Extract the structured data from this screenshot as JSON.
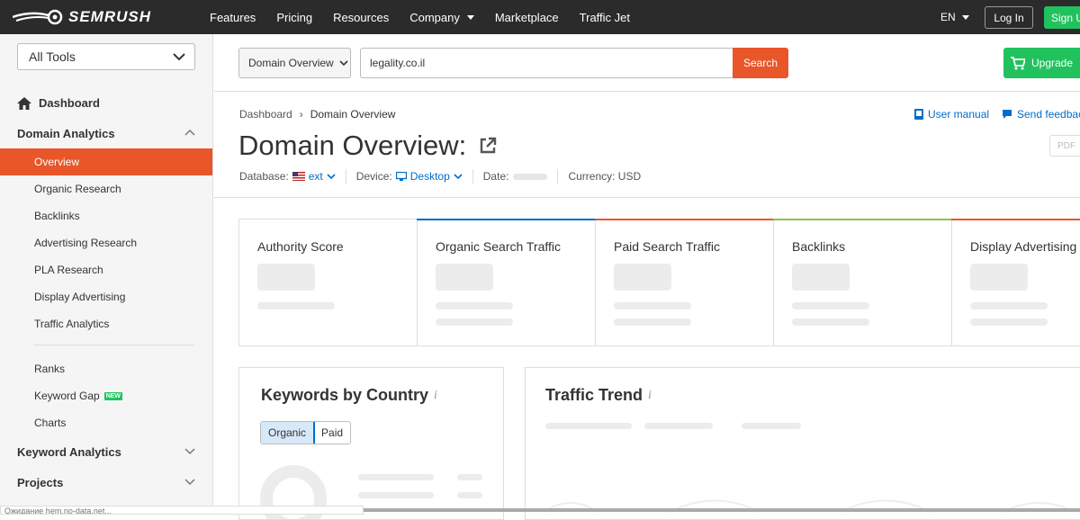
{
  "topbar": {
    "logo_text": "SEMRUSH",
    "nav": [
      "Features",
      "Pricing",
      "Resources",
      "Company",
      "Marketplace",
      "Traffic Jet"
    ],
    "lang": "EN",
    "login": "Log In",
    "signup": "Sign Up"
  },
  "sidebar": {
    "all_tools": "All Tools",
    "dashboard": "Dashboard",
    "domain_analytics": "Domain Analytics",
    "items": [
      "Overview",
      "Organic Research",
      "Backlinks",
      "Advertising Research",
      "PLA Research",
      "Display Advertising",
      "Traffic Analytics"
    ],
    "items2": [
      "Ranks",
      "Keyword Gap",
      "Charts"
    ],
    "new_badge": "NEW",
    "keyword_analytics": "Keyword Analytics",
    "projects": "Projects"
  },
  "search": {
    "db_select": "Domain Overview",
    "query": "legality.co.il",
    "button": "Search",
    "upgrade": "Upgrade"
  },
  "header": {
    "breadcrumb": [
      "Dashboard",
      "Domain Overview"
    ],
    "user_manual": "User manual",
    "send_feedback": "Send feedback",
    "title": "Domain Overview:",
    "pdf": "PDF",
    "database_label": "Database:",
    "database_value": "ext",
    "device_label": "Device:",
    "device_value": "Desktop",
    "date_label": "Date:",
    "currency": "Currency: USD"
  },
  "cards": [
    {
      "title": "Authority Score",
      "accent": ""
    },
    {
      "title": "Organic Search Traffic",
      "accent": "#006dca"
    },
    {
      "title": "Paid Search Traffic",
      "accent": "#e8562a"
    },
    {
      "title": "Backlinks",
      "accent": "#8bc34a"
    },
    {
      "title": "Display Advertising",
      "accent": "#e8562a"
    }
  ],
  "keywords_panel": {
    "title": "Keywords by Country",
    "tab_organic": "Organic",
    "tab_paid": "Paid"
  },
  "traffic_panel": {
    "title": "Traffic Trend"
  },
  "statusbar": "Ожидание hem.no-data.net..."
}
